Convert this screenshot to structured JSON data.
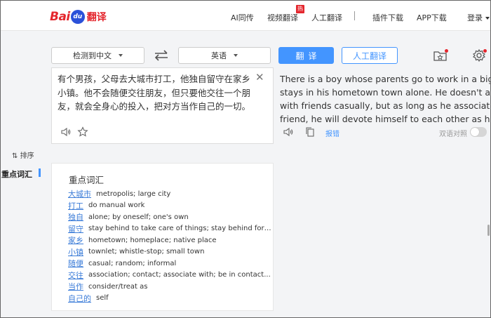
{
  "brand": {
    "bai": "Bai",
    "du": "du",
    "fanyi": "翻译",
    "color": "#e4262d"
  },
  "nav": {
    "items": [
      {
        "label": "AI同传"
      },
      {
        "label": "视频翻译",
        "badge": "热"
      },
      {
        "label": "人工翻译"
      },
      {
        "label": "插件下载"
      },
      {
        "label": "APP下载"
      }
    ],
    "login": "登录"
  },
  "toolbar": {
    "source_lang": "检测到中文",
    "target_lang": "英语",
    "translate_button": "翻译",
    "human_translate_button": "人工翻译",
    "accent": "#4395ff"
  },
  "source": {
    "text": "有个男孩，父母去大城市打工，他独自留守在家乡小镇。他不会随便交往朋友，但只要他交往一个朋友，就会全身心的投入，把对方当作自己的一切。"
  },
  "target": {
    "lines": [
      "There is a boy whose parents go to work in a big city. He",
      "stays in his hometown town alone. He doesn't associate",
      "with friends casually, but as long as he associates with a",
      "friend, he will devote himself to each other as his own."
    ],
    "report": "报错",
    "bilingual_label": "双语对照"
  },
  "sidebar": {
    "sort": "排序",
    "vocab": "重点词汇"
  },
  "vocab": {
    "title": "重点词汇",
    "items": [
      {
        "word": "大城市",
        "meaning": "metropolis; large city"
      },
      {
        "word": "打工",
        "meaning": "do manual work"
      },
      {
        "word": "独自",
        "meaning": "alone; by oneself; one's own"
      },
      {
        "word": "留守",
        "meaning": "stay behind to take care of things; stay behind for ..."
      },
      {
        "word": "家乡",
        "meaning": "hometown; homeplace; native place"
      },
      {
        "word": "小镇",
        "meaning": "townlet; whistle-stop; small town"
      },
      {
        "word": "随便",
        "meaning": "casual; random; informal"
      },
      {
        "word": "交往",
        "meaning": "association; contact; associate with; be in contact..."
      },
      {
        "word": "当作",
        "meaning": "consider/treat as"
      },
      {
        "word": "自己的",
        "meaning": "self"
      }
    ]
  }
}
